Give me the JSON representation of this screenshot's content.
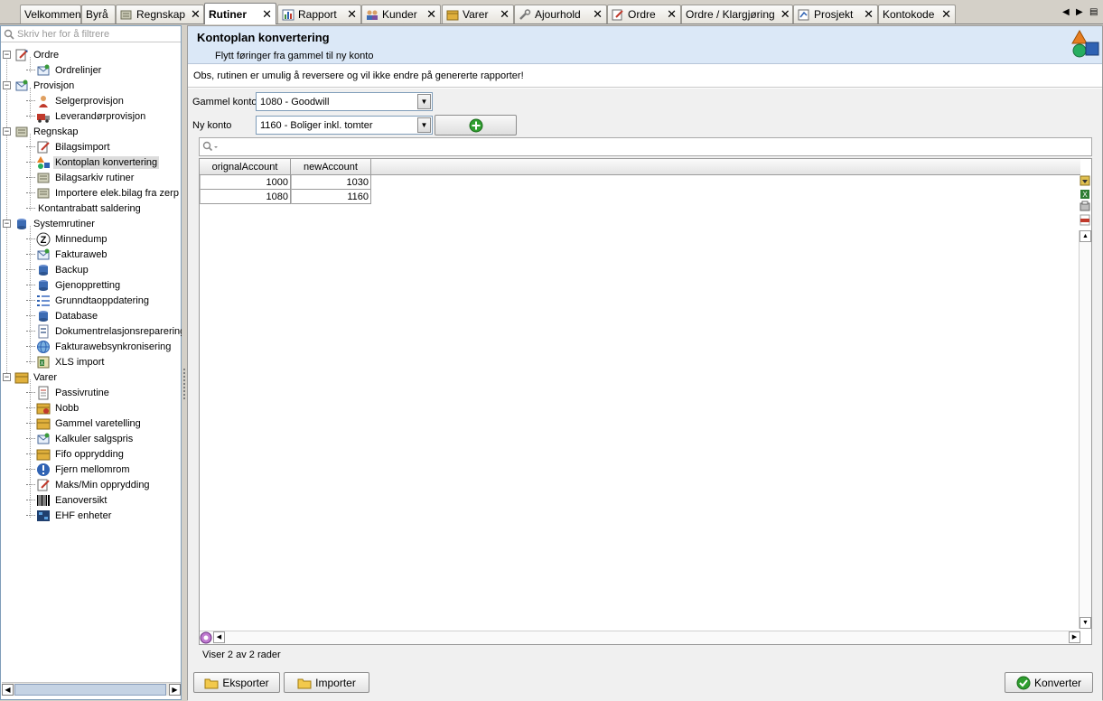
{
  "tabs": [
    {
      "label": "Velkommen",
      "icon": "none",
      "closable": false
    },
    {
      "label": "Byrå",
      "icon": "none",
      "closable": false
    },
    {
      "label": "Regnskap",
      "icon": "ledger-icon",
      "closable": true
    },
    {
      "label": "Rutiner",
      "icon": "none",
      "closable": true,
      "active": true
    },
    {
      "label": "Rapport",
      "icon": "chart-icon",
      "closable": true
    },
    {
      "label": "Kunder",
      "icon": "people-icon",
      "closable": true
    },
    {
      "label": "Varer",
      "icon": "box-icon",
      "closable": true
    },
    {
      "label": "Ajourhold",
      "icon": "wrench-icon",
      "closable": true
    },
    {
      "label": "Ordre",
      "icon": "edit-icon",
      "closable": true
    },
    {
      "label": "Ordre / Klargjøring",
      "icon": "none",
      "closable": true
    },
    {
      "label": "Prosjekt",
      "icon": "project-icon",
      "closable": true
    },
    {
      "label": "Kontokode",
      "icon": "none",
      "closable": true
    }
  ],
  "tabnav": {
    "left": "◀",
    "right": "▶",
    "menu": "▤"
  },
  "sidebar": {
    "filter_placeholder": "Skriv her for å filtrere",
    "groups": [
      {
        "label": "Ordre",
        "icon": "edit-icon",
        "items": [
          {
            "label": "Ordrelinjer",
            "icon": "envelope-icon"
          }
        ]
      },
      {
        "label": "Provisjon",
        "icon": "envelope-icon",
        "items": [
          {
            "label": "Selgerprovisjon",
            "icon": "person-icon"
          },
          {
            "label": "Leverandørprovisjon",
            "icon": "truck-icon"
          }
        ]
      },
      {
        "label": "Regnskap",
        "icon": "ledger-icon",
        "items": [
          {
            "label": "Bilagsimport",
            "icon": "edit-icon"
          },
          {
            "label": "Kontoplan konvertering",
            "icon": "shapes-icon",
            "selected": true
          },
          {
            "label": "Bilagsarkiv rutiner",
            "icon": "ledger-icon"
          },
          {
            "label": "Importere elek.bilag fra zerp",
            "icon": "ledger-icon"
          },
          {
            "label": "Kontantrabatt saldering",
            "icon": "none"
          }
        ]
      },
      {
        "label": "Systemrutiner",
        "icon": "database-icon",
        "items": [
          {
            "label": "Minnedump",
            "icon": "z-icon"
          },
          {
            "label": "Fakturaweb",
            "icon": "envelope-icon"
          },
          {
            "label": "Backup",
            "icon": "database-icon"
          },
          {
            "label": "Gjenoppretting",
            "icon": "database-icon"
          },
          {
            "label": "Grunndtaoppdatering",
            "icon": "list-icon"
          },
          {
            "label": "Database",
            "icon": "database-icon"
          },
          {
            "label": "Dokumentrelasjonsreparering",
            "icon": "document-icon"
          },
          {
            "label": "Fakturawebsynkronisering",
            "icon": "globe-icon"
          },
          {
            "label": "XLS import",
            "icon": "spreadsheet-icon"
          }
        ]
      },
      {
        "label": "Varer",
        "icon": "box-icon",
        "items": [
          {
            "label": "Passivrutine",
            "icon": "document-icon"
          },
          {
            "label": "Nobb",
            "icon": "box-icon"
          },
          {
            "label": "Gammel varetelling",
            "icon": "box-icon"
          },
          {
            "label": "Kalkuler salgspris",
            "icon": "envelope-icon"
          },
          {
            "label": "Fifo opprydding",
            "icon": "box-icon"
          },
          {
            "label": "Fjern mellomrom",
            "icon": "info-icon"
          },
          {
            "label": "Maks/Min opprydding",
            "icon": "edit-icon"
          },
          {
            "label": "Eanoversikt",
            "icon": "barcode-icon"
          },
          {
            "label": "EHF enheter",
            "icon": "ehf-icon"
          }
        ]
      }
    ]
  },
  "header": {
    "title": "Kontoplan konvertering",
    "subtitle": "Flytt føringer fra gammel til ny konto"
  },
  "warning": "Obs, rutinen er umulig å reversere og vil ikke endre på genererte rapporter!",
  "form": {
    "old_label": "Gammel konto",
    "old_value": "1080 -  Goodwill",
    "new_label": "Ny konto",
    "new_value": "1160 -  Boliger inkl. tomter"
  },
  "grid": {
    "columns": [
      "orignalAccount",
      "newAccount"
    ],
    "rows": [
      {
        "orignalAccount": "1000",
        "newAccount": "1030"
      },
      {
        "orignalAccount": "1080",
        "newAccount": "1160"
      }
    ],
    "status": "Viser 2 av 2 rader"
  },
  "buttons": {
    "export": "Eksporter",
    "import": "Importer",
    "convert": "Konverter"
  },
  "colors": {
    "header_bg": "#dbe8f7",
    "add_icon": "#2f9e2f",
    "convert_icon": "#2f9e2f"
  }
}
